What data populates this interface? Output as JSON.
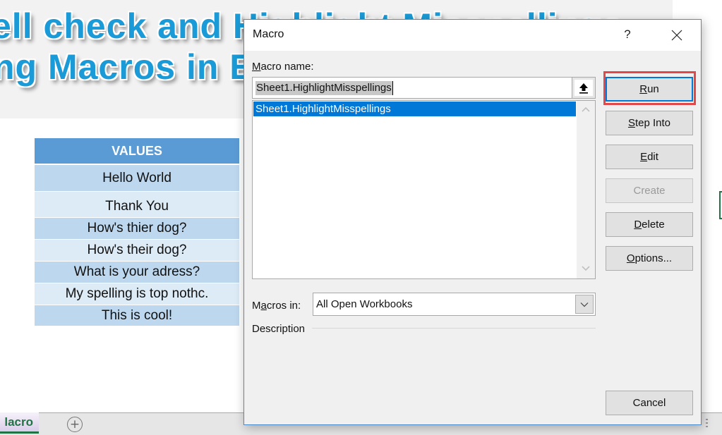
{
  "spreadsheet": {
    "banner": {
      "line1": "ell check and Highlight Misspellings",
      "line2": "ng Macros in Excel"
    },
    "values_table": {
      "header": "VALUES",
      "rows": [
        "Hello World",
        "Thank You",
        "How's thier dog?",
        "How's their dog?",
        "What is your adress?",
        "My spelling is top nothc.",
        "This is cool!"
      ]
    },
    "sheet_tabs": {
      "active_tab": "lacro",
      "add_sheet_icon": "plus-circle-icon"
    }
  },
  "dialog": {
    "title": "Macro",
    "help_label": "?",
    "close_icon": "close-icon",
    "macro_name_label": "Macro name:",
    "macro_name_label_access_key": "M",
    "macro_name_value": "Sheet1.HighlightMisspellings",
    "collapse_icon": "arrow-up-collapse-icon",
    "macro_list": [
      {
        "label": "Sheet1.HighlightMisspellings",
        "selected": true
      }
    ],
    "macros_in_label": "Macros in:",
    "macros_in_value": "All Open Workbooks",
    "description_label": "Description",
    "buttons": {
      "run": "Run",
      "step_into": "Step Into",
      "edit": "Edit",
      "create": "Create",
      "delete": "Delete",
      "options": "Options...",
      "cancel": "Cancel"
    },
    "colors": {
      "selection": "#0078d7",
      "highlight_box": "#e0484a",
      "table_header": "#5b9bd5"
    }
  }
}
